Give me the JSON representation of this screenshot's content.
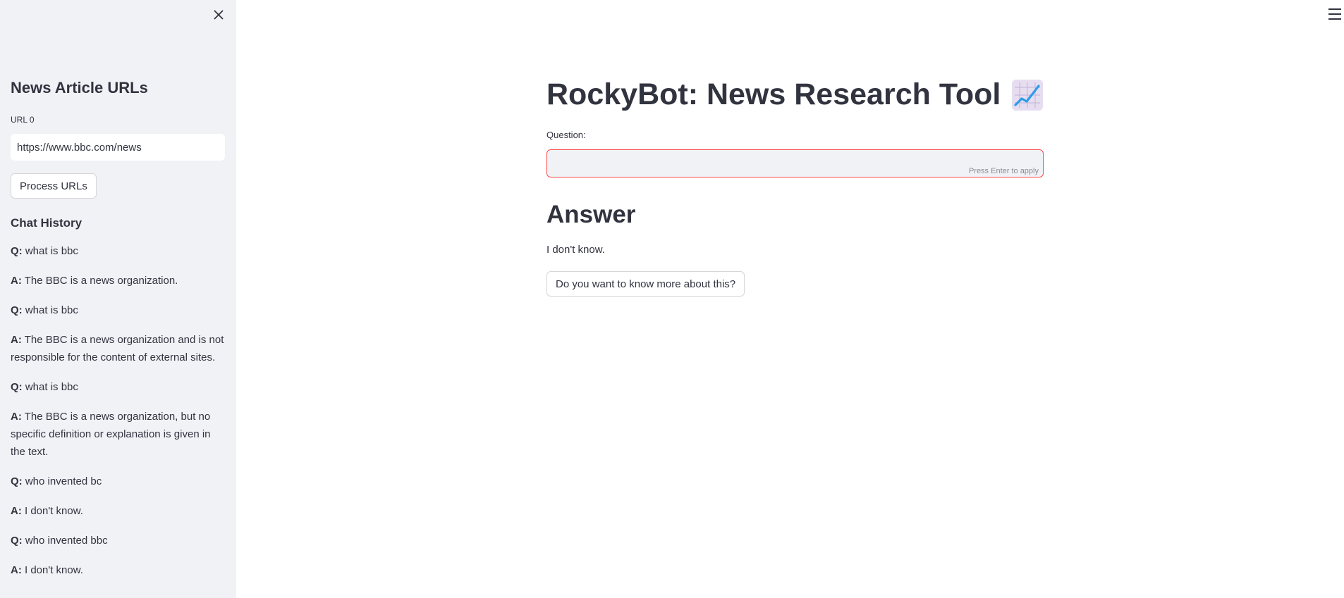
{
  "sidebar": {
    "title": "News Article URLs",
    "url_label": "URL 0",
    "url_value": "https://www.bbc.com/news",
    "process_button": "Process URLs",
    "history_title": "Chat History",
    "history": [
      {
        "prefix": "Q:",
        "text": "what is bbc"
      },
      {
        "prefix": "A:",
        "text": "The BBC is a news organization."
      },
      {
        "prefix": "Q:",
        "text": "what is bbc"
      },
      {
        "prefix": "A:",
        "text": "The BBC is a news organization and is not responsible for the content of external sites."
      },
      {
        "prefix": "Q:",
        "text": "what is bbc"
      },
      {
        "prefix": "A:",
        "text": "The BBC is a news organization, but no specific definition or explanation is given in the text."
      },
      {
        "prefix": "Q:",
        "text": "who invented bc"
      },
      {
        "prefix": "A:",
        "text": "I don't know."
      },
      {
        "prefix": "Q:",
        "text": "who invented bbc"
      },
      {
        "prefix": "A:",
        "text": "I don't know."
      }
    ]
  },
  "main": {
    "title": "RockyBot: News Research Tool",
    "title_icon": "chart-increasing-icon",
    "question_label": "Question:",
    "question_value": "",
    "enter_hint": "Press Enter to apply",
    "answer_title": "Answer",
    "answer_text": "I don't know.",
    "more_button": "Do you want to know more about this?"
  },
  "colors": {
    "sidebar_bg": "#f0f2f6",
    "text": "#31333f",
    "error_border": "#ff4b4b"
  }
}
